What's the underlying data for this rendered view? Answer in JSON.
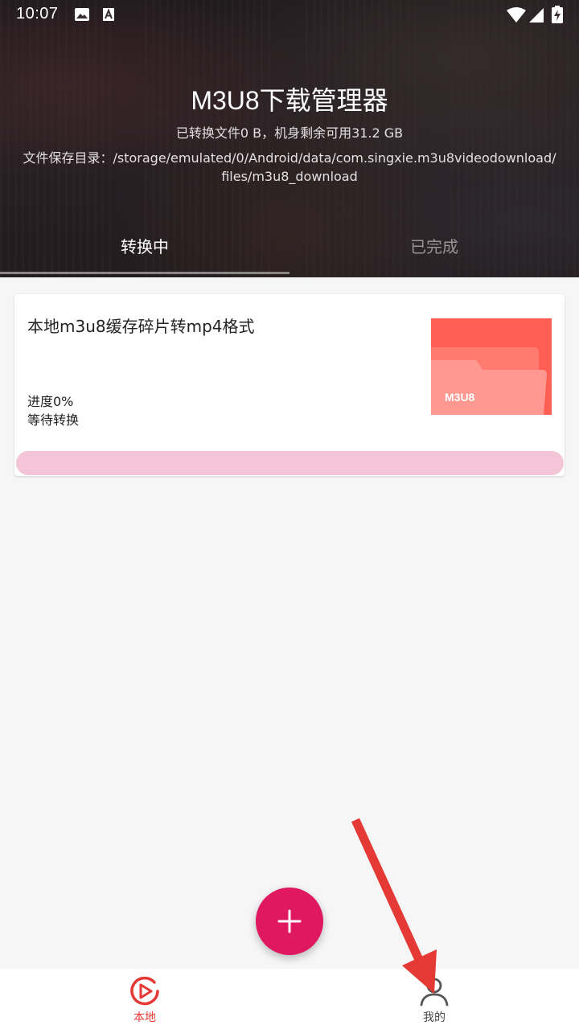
{
  "status_bar": {
    "time": "10:07"
  },
  "header": {
    "title": "M3U8下载管理器",
    "storage_info": "已转换文件0 B，机身剩余可用31.2 GB",
    "save_dir_line1": "文件保存目录：/storage/emulated/0/Android/data/com.singxie.m3u8videodownload/",
    "save_dir_line2": "files/m3u8_download"
  },
  "tabs": [
    {
      "label": "转换中",
      "active": true
    },
    {
      "label": "已完成",
      "active": false
    }
  ],
  "task": {
    "title": "本地m3u8缓存碎片转mp4格式",
    "progress_text": "进度0%",
    "progress_value": 0,
    "status": "等待转换",
    "thumbnail_label": "M3U8"
  },
  "fab": {
    "icon": "plus-icon"
  },
  "bottom_nav": [
    {
      "label": "本地",
      "icon": "play-circle-icon",
      "active": true
    },
    {
      "label": "我的",
      "icon": "person-icon",
      "active": false
    }
  ],
  "colors": {
    "accent": "#e0185f",
    "nav_active": "#e53935",
    "progress_track": "#f4c4d7",
    "thumbnail": "#ff5e52",
    "annotation_arrow": "#e53935"
  }
}
